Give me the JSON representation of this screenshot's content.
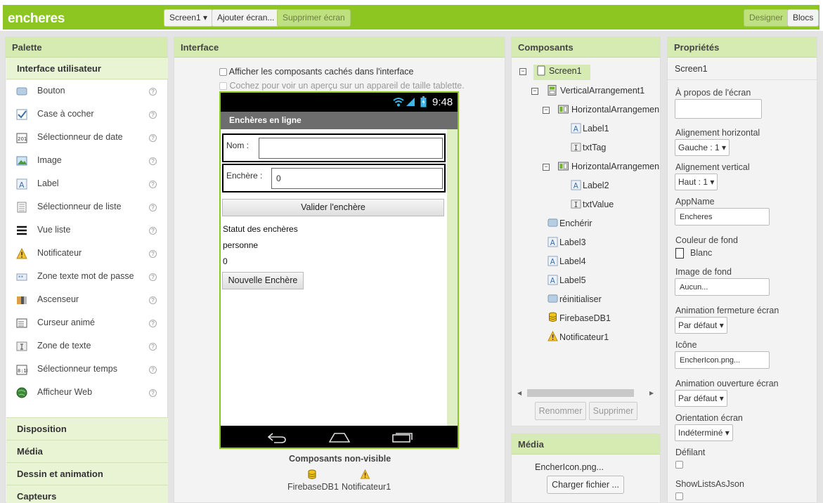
{
  "app_title": "encheres",
  "toolbar": {
    "screen_select": "Screen1 ▾",
    "add_screen": "Ajouter écran...",
    "remove_screen": "Supprimer écran",
    "designer": "Designer",
    "blocks": "Blocs"
  },
  "palette": {
    "title": "Palette",
    "category_open": "Interface utilisateur",
    "items": [
      {
        "label": "Bouton",
        "icon": "button-icon"
      },
      {
        "label": "Case à cocher",
        "icon": "checkbox-icon"
      },
      {
        "label": "Sélectionneur de date",
        "icon": "calendar-icon"
      },
      {
        "label": "Image",
        "icon": "image-icon"
      },
      {
        "label": "Label",
        "icon": "label-icon"
      },
      {
        "label": "Sélectionneur de liste",
        "icon": "listpicker-icon"
      },
      {
        "label": "Vue liste",
        "icon": "listview-icon"
      },
      {
        "label": "Notificateur",
        "icon": "warning-icon"
      },
      {
        "label": "Zone texte mot de passe",
        "icon": "password-icon"
      },
      {
        "label": "Ascenseur",
        "icon": "slider-icon"
      },
      {
        "label": "Curseur animé",
        "icon": "spinner-icon"
      },
      {
        "label": "Zone de texte",
        "icon": "textbox-icon"
      },
      {
        "label": "Sélectionneur temps",
        "icon": "clock-icon"
      },
      {
        "label": "Afficheur Web",
        "icon": "globe-icon"
      }
    ],
    "help": "?",
    "categories": [
      "Disposition",
      "Média",
      "Dessin et animation",
      "Capteurs"
    ]
  },
  "viewer": {
    "title": "Interface",
    "show_hidden": "Afficher les composants cachés dans l'interface",
    "tablet_preview": "Cochez pour voir un aperçu sur un appareil de taille tablette.",
    "clock": "9:48",
    "screen_title": "Enchères en ligne",
    "nom_label": "Nom :",
    "nom_value": "",
    "enchere_label": "Enchère :",
    "enchere_value": "0",
    "validate_button": "Valider l'enchère",
    "status_label": "Statut des enchères",
    "label4": "personne",
    "label5": "0",
    "new_button": "Nouvelle Enchère",
    "nonvisible_title": "Composants non-visible",
    "nonvisible": [
      "FirebaseDB1",
      "Notificateur1"
    ]
  },
  "components": {
    "title": "Composants",
    "tree": [
      {
        "label": "Screen1",
        "icon": "screen-icon",
        "toggle": "−"
      },
      {
        "label": "VerticalArrangement1",
        "icon": "vertical-arrangement-icon",
        "toggle": "−"
      },
      {
        "label": "HorizontalArrangemen",
        "icon": "horizontal-arrangement-icon",
        "toggle": "−"
      },
      {
        "label": "Label1",
        "icon": "label-icon"
      },
      {
        "label": "txtTag",
        "icon": "textbox-icon"
      },
      {
        "label": "HorizontalArrangemen",
        "icon": "horizontal-arrangement-icon",
        "toggle": "−"
      },
      {
        "label": "Label2",
        "icon": "label-icon"
      },
      {
        "label": "txtValue",
        "icon": "textbox-icon"
      },
      {
        "label": "Enchérir",
        "icon": "button-icon"
      },
      {
        "label": "Label3",
        "icon": "label-icon"
      },
      {
        "label": "Label4",
        "icon": "label-icon"
      },
      {
        "label": "Label5",
        "icon": "label-icon"
      },
      {
        "label": "réinitialiser",
        "icon": "button-icon"
      },
      {
        "label": "FirebaseDB1",
        "icon": "database-icon"
      },
      {
        "label": "Notificateur1",
        "icon": "warning-icon"
      }
    ],
    "rename": "Renommer",
    "delete": "Supprimer"
  },
  "media": {
    "title": "Média",
    "file": "EncherIcon.png...",
    "upload": "Charger fichier ..."
  },
  "properties": {
    "title": "Propriétés",
    "component": "Screen1",
    "about_label": "À propos de l'écran",
    "about_value": "",
    "halign_label": "Alignement horizontal",
    "halign_value": "Gauche : 1 ▾",
    "valign_label": "Alignement vertical",
    "valign_value": "Haut : 1 ▾",
    "appname_label": "AppName",
    "appname_value": "Encheres",
    "bgcolor_label": "Couleur de fond",
    "bgcolor_value": "Blanc",
    "bgimage_label": "Image de fond",
    "bgimage_value": "Aucun...",
    "close_anim_label": "Animation fermeture écran",
    "close_anim_value": "Par défaut ▾",
    "icon_label": "Icône",
    "icon_value": "EncherIcon.png...",
    "open_anim_label": "Animation ouverture écran",
    "open_anim_value": "Par défaut ▾",
    "orientation_label": "Orientation écran",
    "orientation_value": "Indéterminé ▾",
    "scrollable_label": "Défilant",
    "showlists_label": "ShowListsAsJson"
  },
  "colors": {
    "accent": "#8dc621",
    "header": "#d6ebb2"
  }
}
